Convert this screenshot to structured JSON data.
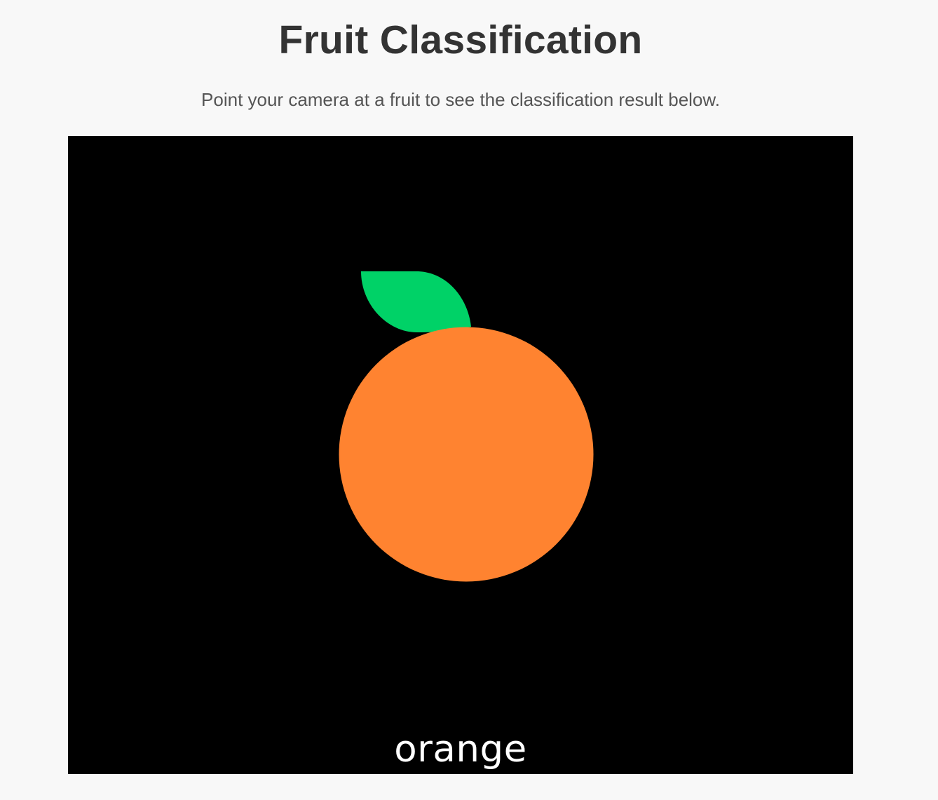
{
  "header": {
    "title": "Fruit Classification",
    "subtitle": "Point your camera at a fruit to see the classification result below."
  },
  "camera": {
    "background_color": "#000000",
    "fruit_color": "#ff8330",
    "leaf_color": "#00d267",
    "classification_result": "orange"
  }
}
